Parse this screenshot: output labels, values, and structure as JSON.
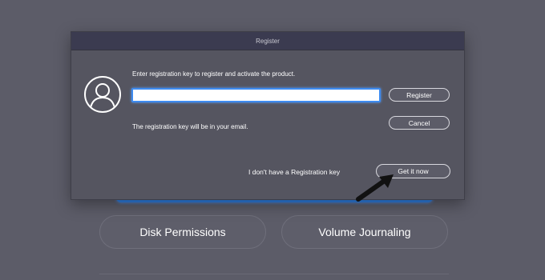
{
  "dialog": {
    "title": "Register",
    "prompt": "Enter registration key to register and activate the product.",
    "key_input": {
      "value": "",
      "placeholder": ""
    },
    "note": "The registration key will be in your email.",
    "register_label": "Register",
    "cancel_label": "Cancel",
    "no_key_text": "I don't have a Registration key",
    "get_it_now_label": "Get it now",
    "avatar_icon": "user-avatar-icon",
    "accent_color": "#3d8bf0"
  },
  "background": {
    "buttons": [
      {
        "label": "Disk Permissions"
      },
      {
        "label": "Volume Journaling"
      }
    ]
  },
  "annotation": {
    "pointer_icon": "arrow-icon"
  }
}
